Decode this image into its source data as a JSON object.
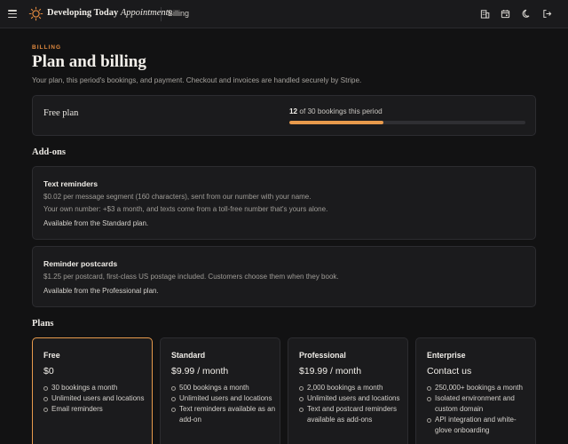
{
  "header": {
    "brand_main": "Developing Today",
    "brand_sub": "Appointments",
    "breadcrumb": "Billing",
    "icons": [
      "menu-icon",
      "sun-logo-icon",
      "building-icon",
      "calendar-icon",
      "theme-moon-icon",
      "logout-icon"
    ]
  },
  "page": {
    "eyebrow": "BILLING",
    "title": "Plan and billing",
    "description": "Your plan, this period's bookings, and payment. Checkout and invoices are handled securely by Stripe."
  },
  "current_plan": {
    "name": "Free plan",
    "used": "12",
    "usage_suffix": "of 30 bookings this period",
    "progress_fraction": 0.4,
    "accent_color": "#e89a4c"
  },
  "addons": {
    "heading": "Add-ons",
    "items": [
      {
        "title": "Text reminders",
        "line1": "$0.02 per message segment (160 characters), sent from our number with your name.",
        "line2": "Your own number: +$3 a month, and texts come from a toll-free number that's yours alone.",
        "availability": "Available from the Standard plan."
      },
      {
        "title": "Reminder postcards",
        "line1": "$1.25 per postcard, first-class US postage included. Customers choose them when they book.",
        "availability": "Available from the Professional plan."
      }
    ]
  },
  "plans": {
    "heading": "Plans",
    "items": [
      {
        "name": "Free",
        "price": "$0",
        "features": [
          "30 bookings a month",
          "Unlimited users and locations",
          "Email reminders"
        ]
      },
      {
        "name": "Standard",
        "price": "$9.99 / month",
        "features": [
          "500 bookings a month",
          "Unlimited users and locations",
          "Text reminders available as an add-on"
        ]
      },
      {
        "name": "Professional",
        "price": "$19.99 / month",
        "features": [
          "2,000 bookings a month",
          "Unlimited users and locations",
          "Text and postcard reminders available as add-ons"
        ]
      },
      {
        "name": "Enterprise",
        "price": "Contact us",
        "features": [
          "250,000+ bookings a month",
          "Isolated environment and custom domain",
          "API integration and white-glove onboarding"
        ]
      }
    ]
  }
}
